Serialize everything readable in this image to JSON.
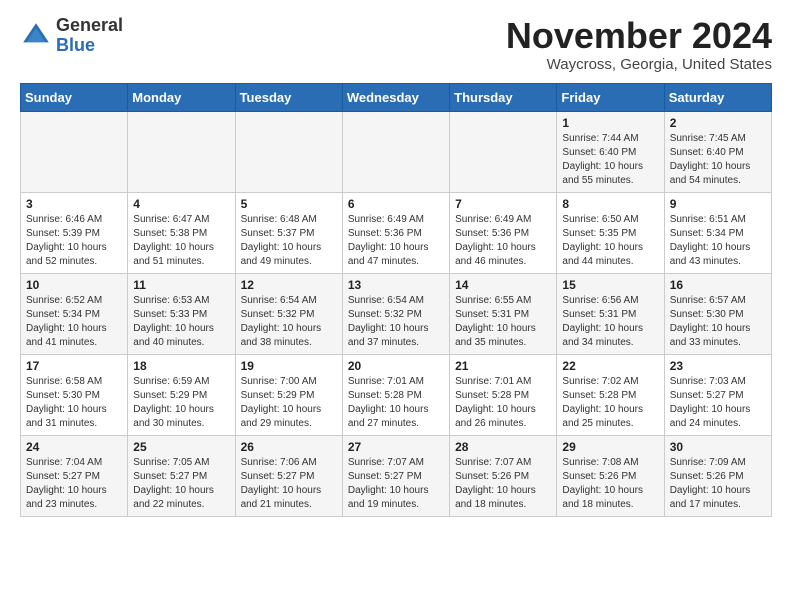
{
  "header": {
    "logo_general": "General",
    "logo_blue": "Blue",
    "month_title": "November 2024",
    "location": "Waycross, Georgia, United States"
  },
  "days_of_week": [
    "Sunday",
    "Monday",
    "Tuesday",
    "Wednesday",
    "Thursday",
    "Friday",
    "Saturday"
  ],
  "weeks": [
    [
      {
        "day": "",
        "info": ""
      },
      {
        "day": "",
        "info": ""
      },
      {
        "day": "",
        "info": ""
      },
      {
        "day": "",
        "info": ""
      },
      {
        "day": "",
        "info": ""
      },
      {
        "day": "1",
        "info": "Sunrise: 7:44 AM\nSunset: 6:40 PM\nDaylight: 10 hours\nand 55 minutes."
      },
      {
        "day": "2",
        "info": "Sunrise: 7:45 AM\nSunset: 6:40 PM\nDaylight: 10 hours\nand 54 minutes."
      }
    ],
    [
      {
        "day": "3",
        "info": "Sunrise: 6:46 AM\nSunset: 5:39 PM\nDaylight: 10 hours\nand 52 minutes."
      },
      {
        "day": "4",
        "info": "Sunrise: 6:47 AM\nSunset: 5:38 PM\nDaylight: 10 hours\nand 51 minutes."
      },
      {
        "day": "5",
        "info": "Sunrise: 6:48 AM\nSunset: 5:37 PM\nDaylight: 10 hours\nand 49 minutes."
      },
      {
        "day": "6",
        "info": "Sunrise: 6:49 AM\nSunset: 5:36 PM\nDaylight: 10 hours\nand 47 minutes."
      },
      {
        "day": "7",
        "info": "Sunrise: 6:49 AM\nSunset: 5:36 PM\nDaylight: 10 hours\nand 46 minutes."
      },
      {
        "day": "8",
        "info": "Sunrise: 6:50 AM\nSunset: 5:35 PM\nDaylight: 10 hours\nand 44 minutes."
      },
      {
        "day": "9",
        "info": "Sunrise: 6:51 AM\nSunset: 5:34 PM\nDaylight: 10 hours\nand 43 minutes."
      }
    ],
    [
      {
        "day": "10",
        "info": "Sunrise: 6:52 AM\nSunset: 5:34 PM\nDaylight: 10 hours\nand 41 minutes."
      },
      {
        "day": "11",
        "info": "Sunrise: 6:53 AM\nSunset: 5:33 PM\nDaylight: 10 hours\nand 40 minutes."
      },
      {
        "day": "12",
        "info": "Sunrise: 6:54 AM\nSunset: 5:32 PM\nDaylight: 10 hours\nand 38 minutes."
      },
      {
        "day": "13",
        "info": "Sunrise: 6:54 AM\nSunset: 5:32 PM\nDaylight: 10 hours\nand 37 minutes."
      },
      {
        "day": "14",
        "info": "Sunrise: 6:55 AM\nSunset: 5:31 PM\nDaylight: 10 hours\nand 35 minutes."
      },
      {
        "day": "15",
        "info": "Sunrise: 6:56 AM\nSunset: 5:31 PM\nDaylight: 10 hours\nand 34 minutes."
      },
      {
        "day": "16",
        "info": "Sunrise: 6:57 AM\nSunset: 5:30 PM\nDaylight: 10 hours\nand 33 minutes."
      }
    ],
    [
      {
        "day": "17",
        "info": "Sunrise: 6:58 AM\nSunset: 5:30 PM\nDaylight: 10 hours\nand 31 minutes."
      },
      {
        "day": "18",
        "info": "Sunrise: 6:59 AM\nSunset: 5:29 PM\nDaylight: 10 hours\nand 30 minutes."
      },
      {
        "day": "19",
        "info": "Sunrise: 7:00 AM\nSunset: 5:29 PM\nDaylight: 10 hours\nand 29 minutes."
      },
      {
        "day": "20",
        "info": "Sunrise: 7:01 AM\nSunset: 5:28 PM\nDaylight: 10 hours\nand 27 minutes."
      },
      {
        "day": "21",
        "info": "Sunrise: 7:01 AM\nSunset: 5:28 PM\nDaylight: 10 hours\nand 26 minutes."
      },
      {
        "day": "22",
        "info": "Sunrise: 7:02 AM\nSunset: 5:28 PM\nDaylight: 10 hours\nand 25 minutes."
      },
      {
        "day": "23",
        "info": "Sunrise: 7:03 AM\nSunset: 5:27 PM\nDaylight: 10 hours\nand 24 minutes."
      }
    ],
    [
      {
        "day": "24",
        "info": "Sunrise: 7:04 AM\nSunset: 5:27 PM\nDaylight: 10 hours\nand 23 minutes."
      },
      {
        "day": "25",
        "info": "Sunrise: 7:05 AM\nSunset: 5:27 PM\nDaylight: 10 hours\nand 22 minutes."
      },
      {
        "day": "26",
        "info": "Sunrise: 7:06 AM\nSunset: 5:27 PM\nDaylight: 10 hours\nand 21 minutes."
      },
      {
        "day": "27",
        "info": "Sunrise: 7:07 AM\nSunset: 5:27 PM\nDaylight: 10 hours\nand 19 minutes."
      },
      {
        "day": "28",
        "info": "Sunrise: 7:07 AM\nSunset: 5:26 PM\nDaylight: 10 hours\nand 18 minutes."
      },
      {
        "day": "29",
        "info": "Sunrise: 7:08 AM\nSunset: 5:26 PM\nDaylight: 10 hours\nand 18 minutes."
      },
      {
        "day": "30",
        "info": "Sunrise: 7:09 AM\nSunset: 5:26 PM\nDaylight: 10 hours\nand 17 minutes."
      }
    ]
  ]
}
